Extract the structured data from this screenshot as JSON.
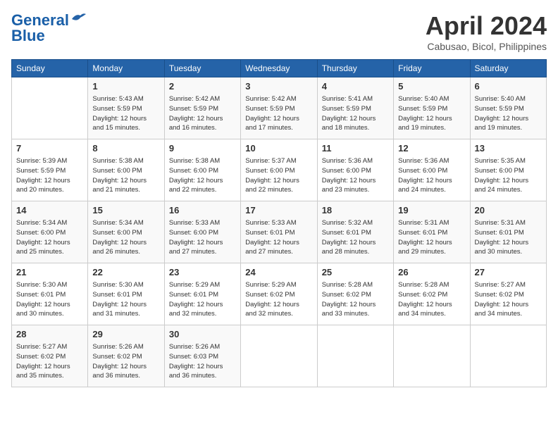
{
  "header": {
    "logo_line1": "General",
    "logo_line2": "Blue",
    "month": "April 2024",
    "location": "Cabusao, Bicol, Philippines"
  },
  "weekdays": [
    "Sunday",
    "Monday",
    "Tuesday",
    "Wednesday",
    "Thursday",
    "Friday",
    "Saturday"
  ],
  "weeks": [
    [
      {
        "day": "",
        "info": ""
      },
      {
        "day": "1",
        "info": "Sunrise: 5:43 AM\nSunset: 5:59 PM\nDaylight: 12 hours\nand 15 minutes."
      },
      {
        "day": "2",
        "info": "Sunrise: 5:42 AM\nSunset: 5:59 PM\nDaylight: 12 hours\nand 16 minutes."
      },
      {
        "day": "3",
        "info": "Sunrise: 5:42 AM\nSunset: 5:59 PM\nDaylight: 12 hours\nand 17 minutes."
      },
      {
        "day": "4",
        "info": "Sunrise: 5:41 AM\nSunset: 5:59 PM\nDaylight: 12 hours\nand 18 minutes."
      },
      {
        "day": "5",
        "info": "Sunrise: 5:40 AM\nSunset: 5:59 PM\nDaylight: 12 hours\nand 19 minutes."
      },
      {
        "day": "6",
        "info": "Sunrise: 5:40 AM\nSunset: 5:59 PM\nDaylight: 12 hours\nand 19 minutes."
      }
    ],
    [
      {
        "day": "7",
        "info": "Sunrise: 5:39 AM\nSunset: 5:59 PM\nDaylight: 12 hours\nand 20 minutes."
      },
      {
        "day": "8",
        "info": "Sunrise: 5:38 AM\nSunset: 6:00 PM\nDaylight: 12 hours\nand 21 minutes."
      },
      {
        "day": "9",
        "info": "Sunrise: 5:38 AM\nSunset: 6:00 PM\nDaylight: 12 hours\nand 22 minutes."
      },
      {
        "day": "10",
        "info": "Sunrise: 5:37 AM\nSunset: 6:00 PM\nDaylight: 12 hours\nand 22 minutes."
      },
      {
        "day": "11",
        "info": "Sunrise: 5:36 AM\nSunset: 6:00 PM\nDaylight: 12 hours\nand 23 minutes."
      },
      {
        "day": "12",
        "info": "Sunrise: 5:36 AM\nSunset: 6:00 PM\nDaylight: 12 hours\nand 24 minutes."
      },
      {
        "day": "13",
        "info": "Sunrise: 5:35 AM\nSunset: 6:00 PM\nDaylight: 12 hours\nand 24 minutes."
      }
    ],
    [
      {
        "day": "14",
        "info": "Sunrise: 5:34 AM\nSunset: 6:00 PM\nDaylight: 12 hours\nand 25 minutes."
      },
      {
        "day": "15",
        "info": "Sunrise: 5:34 AM\nSunset: 6:00 PM\nDaylight: 12 hours\nand 26 minutes."
      },
      {
        "day": "16",
        "info": "Sunrise: 5:33 AM\nSunset: 6:00 PM\nDaylight: 12 hours\nand 27 minutes."
      },
      {
        "day": "17",
        "info": "Sunrise: 5:33 AM\nSunset: 6:01 PM\nDaylight: 12 hours\nand 27 minutes."
      },
      {
        "day": "18",
        "info": "Sunrise: 5:32 AM\nSunset: 6:01 PM\nDaylight: 12 hours\nand 28 minutes."
      },
      {
        "day": "19",
        "info": "Sunrise: 5:31 AM\nSunset: 6:01 PM\nDaylight: 12 hours\nand 29 minutes."
      },
      {
        "day": "20",
        "info": "Sunrise: 5:31 AM\nSunset: 6:01 PM\nDaylight: 12 hours\nand 30 minutes."
      }
    ],
    [
      {
        "day": "21",
        "info": "Sunrise: 5:30 AM\nSunset: 6:01 PM\nDaylight: 12 hours\nand 30 minutes."
      },
      {
        "day": "22",
        "info": "Sunrise: 5:30 AM\nSunset: 6:01 PM\nDaylight: 12 hours\nand 31 minutes."
      },
      {
        "day": "23",
        "info": "Sunrise: 5:29 AM\nSunset: 6:01 PM\nDaylight: 12 hours\nand 32 minutes."
      },
      {
        "day": "24",
        "info": "Sunrise: 5:29 AM\nSunset: 6:02 PM\nDaylight: 12 hours\nand 32 minutes."
      },
      {
        "day": "25",
        "info": "Sunrise: 5:28 AM\nSunset: 6:02 PM\nDaylight: 12 hours\nand 33 minutes."
      },
      {
        "day": "26",
        "info": "Sunrise: 5:28 AM\nSunset: 6:02 PM\nDaylight: 12 hours\nand 34 minutes."
      },
      {
        "day": "27",
        "info": "Sunrise: 5:27 AM\nSunset: 6:02 PM\nDaylight: 12 hours\nand 34 minutes."
      }
    ],
    [
      {
        "day": "28",
        "info": "Sunrise: 5:27 AM\nSunset: 6:02 PM\nDaylight: 12 hours\nand 35 minutes."
      },
      {
        "day": "29",
        "info": "Sunrise: 5:26 AM\nSunset: 6:02 PM\nDaylight: 12 hours\nand 36 minutes."
      },
      {
        "day": "30",
        "info": "Sunrise: 5:26 AM\nSunset: 6:03 PM\nDaylight: 12 hours\nand 36 minutes."
      },
      {
        "day": "",
        "info": ""
      },
      {
        "day": "",
        "info": ""
      },
      {
        "day": "",
        "info": ""
      },
      {
        "day": "",
        "info": ""
      }
    ]
  ]
}
